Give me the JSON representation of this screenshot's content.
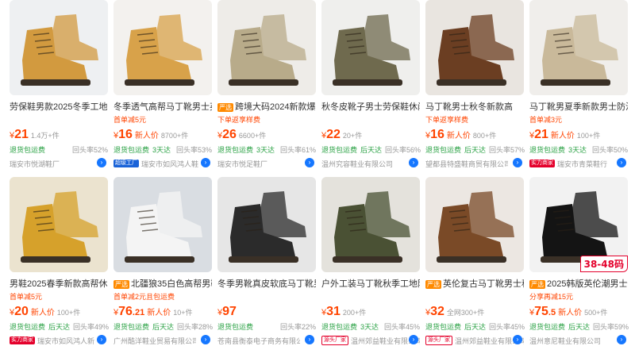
{
  "products": [
    {
      "title": "劳保鞋男款2025冬季工地耐",
      "badge": "",
      "promo": "",
      "price": "21",
      "price_dec": "",
      "new": "",
      "sold": "1.4万+件",
      "svc": [
        "退货包运费"
      ],
      "repeat": "回头率52%",
      "shop_badge": "",
      "shop": "瑞安市悦湖鞋厂",
      "img_color": "#d29a3f",
      "bg": "#eef0f2",
      "img_tag": ""
    },
    {
      "title": "冬季透气高帮马丁靴男士英",
      "badge": "",
      "promo": "首单减5元",
      "price": "16",
      "price_dec": "",
      "new": "新人价",
      "sold": "8700+件",
      "svc": [
        "退货包运费",
        "3天达"
      ],
      "repeat": "回头率53%",
      "shop_badge": "超级工厂",
      "shop": "瑞安市如风鸿人鞋",
      "img_color": "#d8a24a",
      "bg": "#f3f1ee",
      "img_tag": ""
    },
    {
      "title": "跨境大码2024新款爆款",
      "badge": "严选",
      "promo": "下单返享样费",
      "price": "26",
      "price_dec": "",
      "new": "",
      "sold": "6600+件",
      "svc": [
        "退货包运费",
        "3天达"
      ],
      "repeat": "回头率61%",
      "shop_badge": "",
      "shop": "瑞安市悦足鞋厂",
      "img_color": "#b8ab8a",
      "bg": "#eeece8",
      "img_tag": ""
    },
    {
      "title": "秋冬皮靴子男士劳保鞋休闲",
      "badge": "",
      "promo": "",
      "price": "22",
      "price_dec": "",
      "new": "",
      "sold": "20+件",
      "svc": [
        "退货包运费",
        "后天达"
      ],
      "repeat": "回头率56%",
      "shop_badge": "",
      "shop": "温州究容鞋业有限公司",
      "img_color": "#6f6a4e",
      "bg": "#efefed",
      "img_tag": ""
    },
    {
      "title": "马丁靴男士秋冬新款高",
      "badge": "",
      "promo": "下单返享样费",
      "price": "16",
      "price_dec": "",
      "new": "新人价",
      "sold": "800+件",
      "svc": [
        "退货包运费",
        "后天达"
      ],
      "repeat": "回头率57%",
      "shop_badge": "",
      "shop": "望都县特盛鞋商贸有限公司",
      "img_color": "#6b3e22",
      "bg": "#e9e5e0",
      "img_tag": ""
    },
    {
      "title": "马丁靴男夏季新款男士防滑",
      "badge": "",
      "promo": "首单减3元",
      "price": "21",
      "price_dec": "",
      "new": "新人价",
      "sold": "100+件",
      "svc": [
        "退货包运费",
        "3天达"
      ],
      "repeat": "回头率50%",
      "shop_badge": "实力商家",
      "shop": "瑞安市青菜鞋行",
      "img_color": "#c9b99a",
      "bg": "#f0eeeb",
      "img_tag": ""
    },
    {
      "title": "男鞋2025春季新款高帮休闲",
      "badge": "",
      "promo": "首单减5元",
      "price": "20",
      "price_dec": "",
      "new": "新人价",
      "sold": "100+件",
      "svc": [
        "退货包运费",
        "后天达"
      ],
      "repeat": "回头率49%",
      "shop_badge": "实力商家",
      "shop": "瑞安市如风鸿人新",
      "img_color": "#d6a12b",
      "bg": "#ebe3cf",
      "img_tag": ""
    },
    {
      "title": "北疆狼35白色高帮男鞋",
      "badge": "严选",
      "promo": "首单减2元且包运费",
      "price": "76",
      "price_dec": ".21",
      "new": "新人价",
      "sold": "10+件",
      "svc": [
        "退货包运费",
        "后天达"
      ],
      "repeat": "回头率28%",
      "shop_badge": "",
      "shop": "广州酷洋鞋业贸易有限公司",
      "img_color": "#f4f4f4",
      "bg": "#d9dde2",
      "img_tag": ""
    },
    {
      "title": "冬季男靴真皮软底马丁靴男",
      "badge": "",
      "promo": "",
      "price": "97",
      "price_dec": "",
      "new": "",
      "sold": "",
      "svc": [
        "退货包运费"
      ],
      "repeat": "回头率22%",
      "shop_badge": "",
      "shop": "苍南县衡泰电子商务有限公司",
      "img_color": "#2b2b2b",
      "bg": "#e6e6e6",
      "img_tag": ""
    },
    {
      "title": "户外工装马丁靴秋季工地防",
      "badge": "",
      "promo": "",
      "price": "31",
      "price_dec": "",
      "new": "",
      "sold": "200+件",
      "svc": [
        "退货包运费",
        "3天达"
      ],
      "repeat": "回头率45%",
      "shop_badge": "源头厂家",
      "shop": "温州郊益鞋业有限公司",
      "img_color": "#4a5134",
      "bg": "#e4e2dc",
      "img_tag": ""
    },
    {
      "title": "英伦复古马丁靴男士秋",
      "badge": "严选",
      "promo": "",
      "price": "32",
      "price_dec": "",
      "new": "",
      "sold": "全网300+件",
      "svc": [
        "退货包运费",
        "后天达"
      ],
      "repeat": "回头率45%",
      "shop_badge": "源头厂家",
      "shop": "温州郊益鞋业有限公司",
      "img_color": "#7a4a27",
      "bg": "#ece7e2",
      "img_tag": ""
    },
    {
      "title": "2025韩版英伦潮男士休",
      "badge": "严选",
      "promo": "分享再减15元",
      "price": "75",
      "price_dec": ".5",
      "new": "新人价",
      "sold": "500+件",
      "svc": [
        "退货包运费",
        "后天达"
      ],
      "repeat": "回头率59%",
      "shop_badge": "",
      "shop": "温州意尼鞋业有限公司",
      "img_color": "#141414",
      "bg": "#f2f2f2",
      "img_tag": "38-48码"
    }
  ],
  "currency": "¥"
}
